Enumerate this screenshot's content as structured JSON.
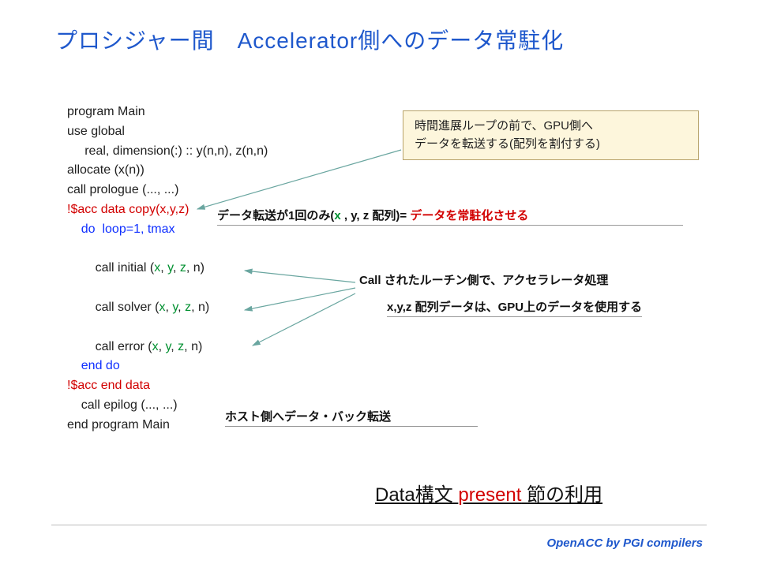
{
  "title": "プロシジャー間　Accelerator側へのデータ常駐化",
  "code": {
    "l1": "program Main",
    "l2": "use global",
    "l3": "     real, dimension(:) :: y(n,n), z(n,n)",
    "l4": "allocate (x(n))",
    "l5": "call prologue (..., ...)",
    "acc_start": "!$acc data copy(x,y,z)",
    "doline_a": "do  loop=1, tmax",
    "call_initial_a": "call initial (",
    "call_solver_a": "call solver (",
    "call_error_a": "call error (",
    "x": "x",
    "y": "y",
    "z": "z",
    "sep": ", ",
    "suffix": ", n)",
    "enddo": "end do",
    "acc_end": "!$acc end data",
    "l_epilog": "call epilog (..., ...)",
    "l_end": "end program Main"
  },
  "callout": {
    "line1": "時間進展ループの前で、GPU側へ",
    "line2": "データを転送する(配列を割付する)"
  },
  "anno1_a": "データ転送が1回のみ(",
  "anno1_x": "x ",
  "anno1_b": ", y, z 配列)= ",
  "anno1_c": "データを常駐化させる",
  "anno2": "Call されたルーチン側で、アクセラレータ処理",
  "anno3": "x,y,z 配列データは、GPU上のデータを使用する",
  "anno4": "ホスト側へデータ・バック転送",
  "big_anno_a": "Data構文 ",
  "big_anno_b": "present",
  "big_anno_c": " 節の利用 ",
  "footer": "OpenACC by PGI compilers"
}
